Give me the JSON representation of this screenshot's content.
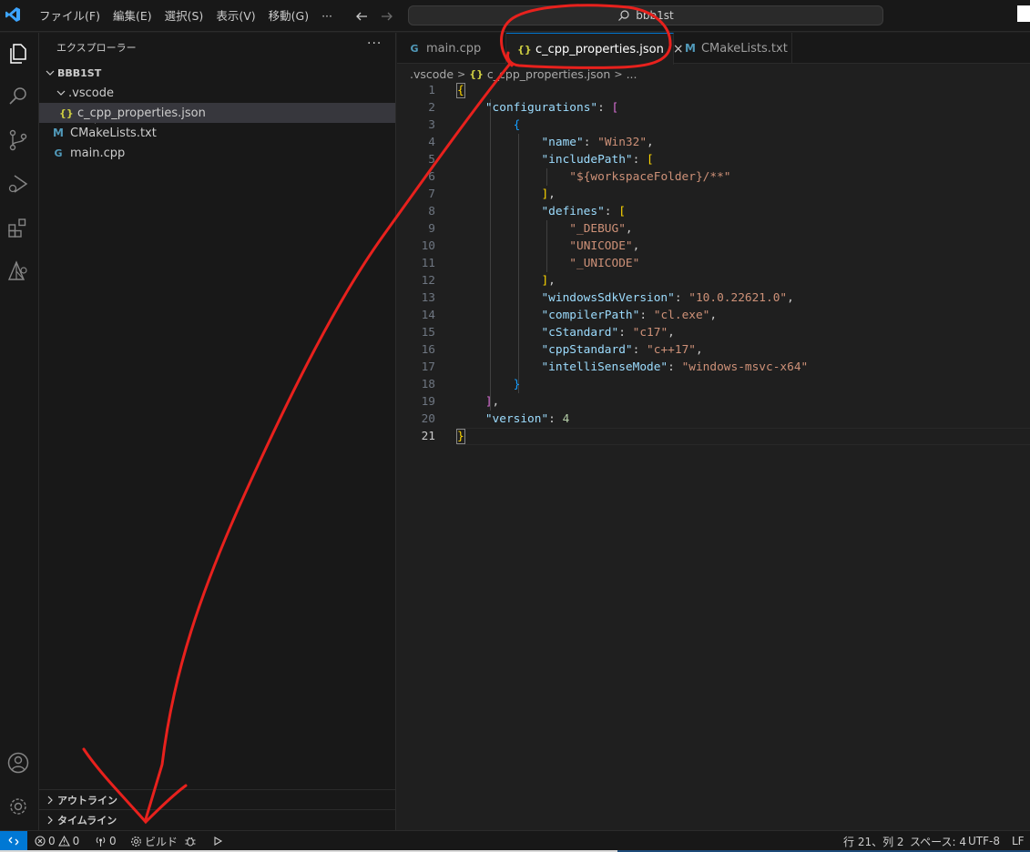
{
  "titlebar": {
    "menu": [
      "ファイル(F)",
      "編集(E)",
      "選択(S)",
      "表示(V)",
      "移動(G)",
      "···"
    ],
    "search_text": "bbb1st"
  },
  "sidebar": {
    "header": "エクスプローラー",
    "more": "···",
    "root_folder": "BBB1ST",
    "items": [
      {
        "label": ".vscode"
      },
      {
        "label": "c_cpp_properties.json",
        "icon": "{}"
      },
      {
        "label": "CMakeLists.txt",
        "icon": "M"
      },
      {
        "label": "main.cpp",
        "icon": "G"
      }
    ],
    "outline": "アウトライン",
    "timeline": "タイムライン"
  },
  "tabs": [
    {
      "label": "main.cpp",
      "icon": "G"
    },
    {
      "label": "c_cpp_properties.json",
      "icon": "{}",
      "close": "×"
    },
    {
      "label": "CMakeLists.txt",
      "icon": "M"
    }
  ],
  "breadcrumb": {
    "folder": ".vscode",
    "file_icon": "{}",
    "file": "c_cpp_properties.json",
    "more": "..."
  },
  "editor": {
    "line_numbers": [
      "1",
      "2",
      "3",
      "4",
      "5",
      "6",
      "7",
      "8",
      "9",
      "10",
      "11",
      "12",
      "13",
      "14",
      "15",
      "16",
      "17",
      "18",
      "19",
      "20",
      "21"
    ],
    "current_line": 21
  },
  "statusbar": {
    "errors": "0",
    "warnings": "0",
    "ports": "0",
    "build": "ビルド",
    "position": "行 21、列 2",
    "spaces": "スペース: 4",
    "encoding": "UTF-8",
    "eol": "LF"
  },
  "colors": {
    "accent": "#0078d4",
    "annotation": "#e8211d"
  }
}
